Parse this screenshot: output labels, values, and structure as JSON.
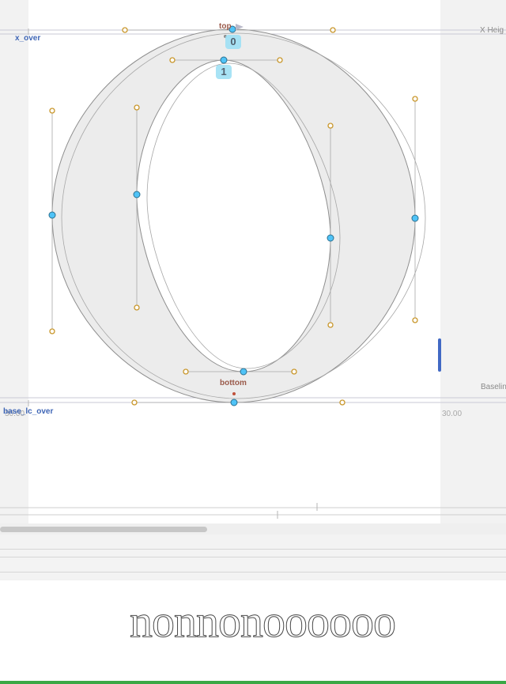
{
  "metrics": {
    "x_over_label": "x_over",
    "x_height_label": "X Heig",
    "baseline_label": "Baselin",
    "base_lc_over_label": "base_lc_over",
    "left_value": "30.00",
    "right_value": "30.00"
  },
  "anchors": {
    "top": "top",
    "bottom": "bottom"
  },
  "nodes": {
    "start_outer": "0",
    "start_inner": "1"
  },
  "preview": {
    "text": "nonnonoooooo"
  },
  "colors": {
    "canvas": "#f2f2f2",
    "glyph_area": "#ffffff",
    "glyph_fill": "#ececec",
    "node_blue": "#4fc3f7",
    "handle_orange": "#c8962a",
    "metric_blue": "#3f66b6",
    "accent_green": "#3aa845"
  }
}
